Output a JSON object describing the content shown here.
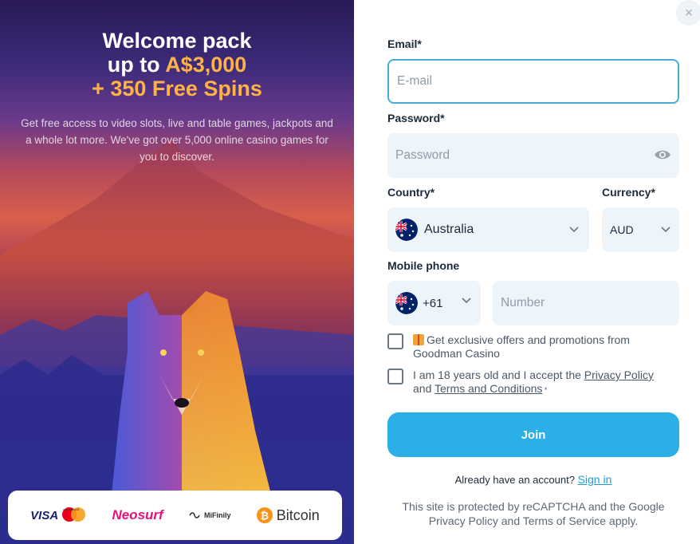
{
  "promo": {
    "title_line1": "Welcome pack",
    "title_line2_prefix": "up to ",
    "title_line2_amount": "A$3,000",
    "title_line3": "+ 350 Free Spins",
    "description": "Get free access to video slots, live and table games, jackpots and a whole lot more. We've got over 5,000 online casino games for you to discover.",
    "payments": {
      "visa": "VISA",
      "mastercard": "mastercard",
      "neosurf": "Neosurf",
      "mifinity": "MiFinily",
      "bitcoin": "Bitcoin",
      "bitcoin_symbol": "₿"
    }
  },
  "form": {
    "close_icon": "×",
    "email_label": "Email*",
    "email_placeholder": "E-mail",
    "password_label": "Password*",
    "password_placeholder": "Password",
    "country_label": "Country*",
    "country_value": "Australia",
    "currency_label": "Currency*",
    "currency_value": "AUD",
    "mobile_label": "Mobile phone",
    "phone_code": "+61",
    "phone_placeholder": "Number",
    "offers_text": "Get exclusive offers and promotions from Goodman Casino",
    "age_prefix": "I am 18 years old and I accept the ",
    "privacy_link": "Privacy Policy",
    "age_and": "and ",
    "terms_link": "Terms and Conditions",
    "age_suffix": " *",
    "join_label": "Join",
    "already_account": "Already have an account?",
    "sign_in": "Sign in",
    "recaptcha_notice": "This site is protected by reCAPTCHA and the Google Privacy Policy and Terms of Service apply."
  },
  "colors": {
    "accent": "#2ab0e6",
    "promo_highlight": "#ffb347",
    "field_bg": "#eef5fa"
  }
}
